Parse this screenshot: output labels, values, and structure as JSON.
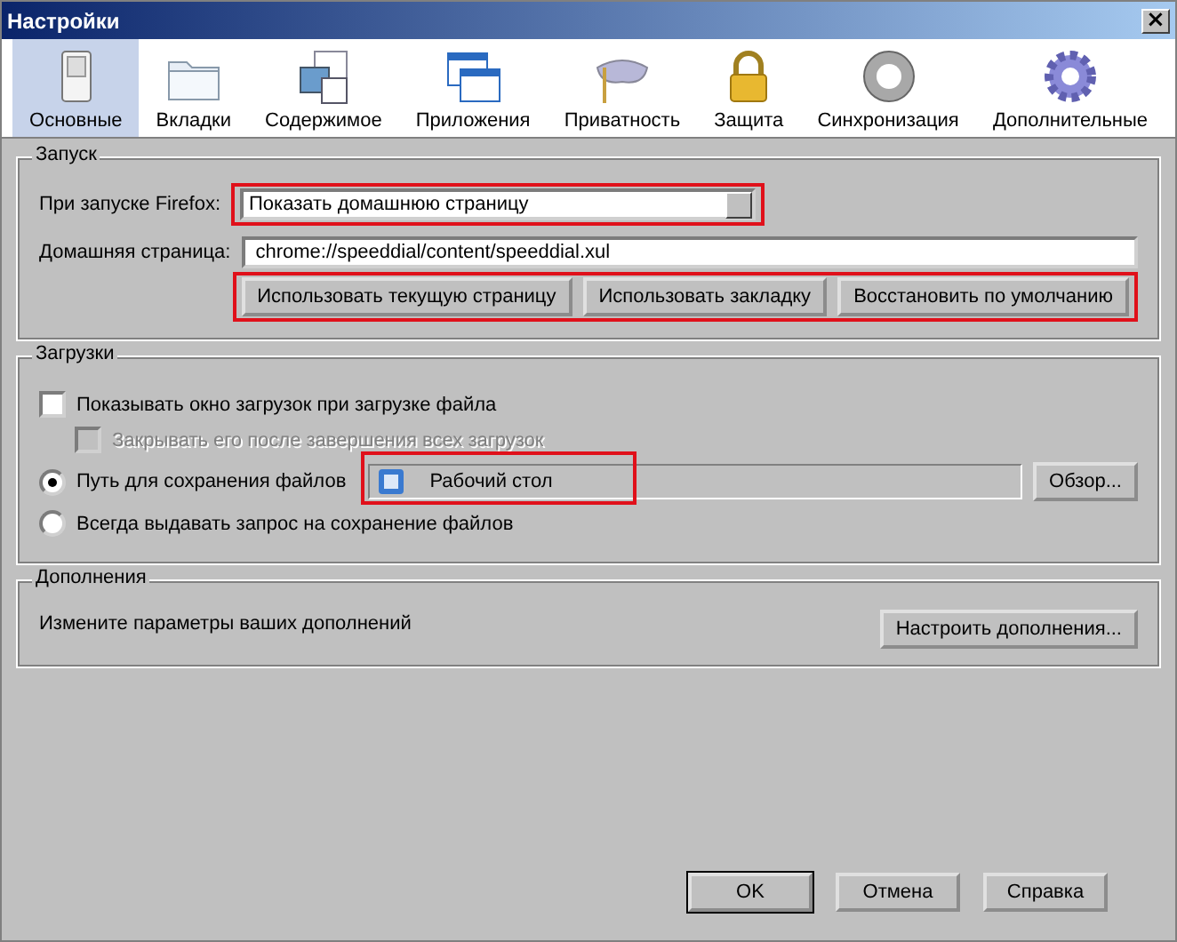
{
  "window": {
    "title": "Настройки",
    "close": "×"
  },
  "toolbar": [
    {
      "label": "Основные",
      "selected": true
    },
    {
      "label": "Вкладки",
      "selected": false
    },
    {
      "label": "Содержимое",
      "selected": false
    },
    {
      "label": "Приложения",
      "selected": false
    },
    {
      "label": "Приватность",
      "selected": false
    },
    {
      "label": "Защита",
      "selected": false
    },
    {
      "label": "Синхронизация",
      "selected": false
    },
    {
      "label": "Дополнительные",
      "selected": false
    }
  ],
  "startup": {
    "title": "Запуск",
    "when_label": "При запуске Firefox:",
    "when_value": "Показать домашнюю страницу",
    "when_highlighted": true,
    "home_label": "Домашняя страница:",
    "home_value": "chrome://speeddial/content/speeddial.xul",
    "buttons_highlighted": true,
    "buttons": [
      "Использовать текущую страницу",
      "Использовать закладку",
      "Восстановить по умолчанию"
    ]
  },
  "downloads": {
    "title": "Загрузки",
    "checkboxes": [
      {
        "label": "Показывать окно загрузок при загрузке файла",
        "checked": false,
        "disabled": false
      },
      {
        "label": "Закрывать его после завершения всех загрузок",
        "checked": false,
        "disabled": true
      }
    ],
    "radios": [
      {
        "label": "Путь для сохранения файлов",
        "selected": true
      },
      {
        "label": "Всегда выдавать запрос на сохранение файлов",
        "selected": false
      }
    ],
    "folder": "Рабочий стол",
    "folder_highlighted": true,
    "browse": "Обзор..."
  },
  "addons": {
    "title": "Дополнения",
    "text": "Измените параметры ваших дополнений",
    "button": "Настроить дополнения..."
  },
  "buttons": [
    "OK",
    "Отмена",
    "Справка"
  ]
}
